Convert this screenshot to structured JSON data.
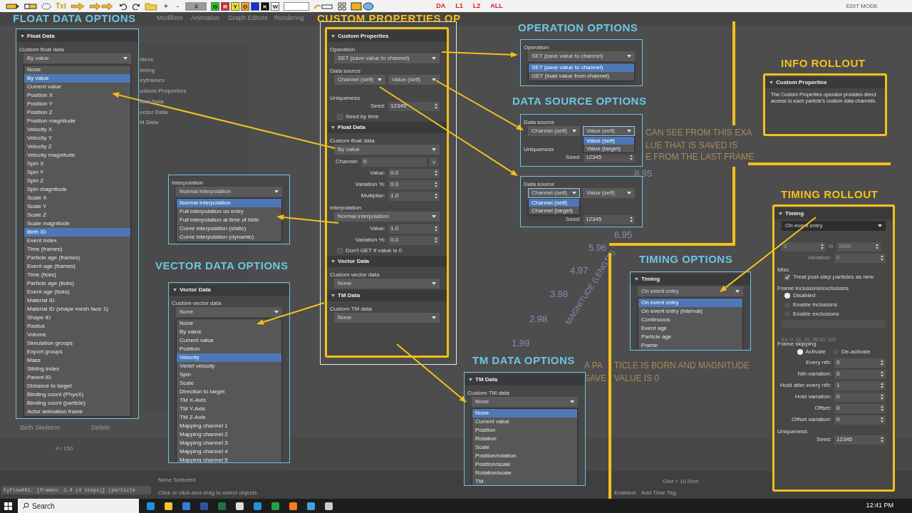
{
  "toolbar": {
    "txt": "Txt",
    "plus": "+",
    "minus": "-",
    "counter": "4",
    "swatches": [
      {
        "label": "G",
        "color": "#1fc51f"
      },
      {
        "label": "R",
        "color": "#e02424"
      },
      {
        "label": "Y",
        "color": "#f2e41c"
      },
      {
        "label": "O",
        "color": "#f0a020"
      },
      {
        "color": "#1a2bd8"
      },
      {
        "label": "K",
        "color": "#000000"
      },
      {
        "label": "W",
        "color": "#ffffff"
      }
    ],
    "tags": [
      "DA",
      "L1",
      "L2",
      "ALL"
    ],
    "mode": "EDIT MODE"
  },
  "background": {
    "menu": [
      "Modifiers",
      "Animation",
      "Graph Editors",
      "Rendering"
    ],
    "tree_items": [
      "ilters",
      "iming",
      "eyframes",
      "ustom Properties",
      "loat Data",
      "ector Data",
      "M Data"
    ],
    "axis_values": [
      "8.95",
      "6.95",
      "5.96",
      "4.97",
      "3.98",
      "2.98",
      "1.99"
    ],
    "axis_title": "MAGNITUDE (LENGTH)",
    "notes": [
      "CAN SEE FROM THIS EXA",
      "LUE THAT IS SAVED IS",
      "E FROM THE LAST FRAME",
      "A PA",
      "TICLE IS BORN AND MAGNITUDE",
      "SAVE",
      "VALUE IS 0"
    ],
    "birth_skeleton": "Birth Skeleton",
    "delete": "Delete",
    "frame_counter": "4 / 150",
    "status": [
      "None Selected",
      "Click or click-and-drag to select objects"
    ],
    "script_line": "tyFlow001: {frames: 1-4 (4 steps)} (particle",
    "enabled": "Enabled:",
    "time_tag": "Add Time Tag",
    "grid": "Grid = 10.0cm"
  },
  "callouts": [
    {
      "title": "FLOAT DATA OPTIONS",
      "color": "#6cc4e4",
      "panels": [
        {
          "rows": [
            {
              "kind": "header",
              "text": "Float Data"
            },
            {
              "kind": "group",
              "text": "Custom float data"
            },
            {
              "kind": "select",
              "value": "By value"
            },
            {
              "kind": "list",
              "items": [
                {
                  "text": "None",
                  "selected": false
                },
                {
                  "text": "By value",
                  "selected": true
                },
                {
                  "text": "Current value",
                  "selected": false
                },
                {
                  "text": "Position X",
                  "selected": false
                },
                {
                  "text": "Position Y",
                  "selected": false
                },
                {
                  "text": "Position Z",
                  "selected": false
                },
                {
                  "text": "Position magnitude",
                  "selected": false
                },
                {
                  "text": "Velocity X",
                  "selected": false
                },
                {
                  "text": "Velocity Y",
                  "selected": false
                },
                {
                  "text": "Velocity Z",
                  "selected": false
                },
                {
                  "text": "Velocity magnitude",
                  "selected": false
                },
                {
                  "text": "Spin X",
                  "selected": false
                },
                {
                  "text": "Spin Y",
                  "selected": false
                },
                {
                  "text": "Spin Z",
                  "selected": false
                },
                {
                  "text": "Spin magnitude",
                  "selected": false
                },
                {
                  "text": "Scale X",
                  "selected": false
                },
                {
                  "text": "Scale Y",
                  "selected": false
                },
                {
                  "text": "Scale Z",
                  "selected": false
                },
                {
                  "text": "Scale magnitude",
                  "selected": false
                },
                {
                  "text": "Birth ID",
                  "selected": true
                },
                {
                  "text": "Event index",
                  "selected": false
                },
                {
                  "text": "Time (frames)",
                  "selected": false
                },
                {
                  "text": "Particle age (frames)",
                  "selected": false
                },
                {
                  "text": "Event age (frames)",
                  "selected": false
                },
                {
                  "text": "Time (ticks)",
                  "selected": false
                },
                {
                  "text": "Particle age (ticks)",
                  "selected": false
                },
                {
                  "text": "Event age (ticks)",
                  "selected": false
                },
                {
                  "text": "Material ID",
                  "selected": false
                },
                {
                  "text": "Material ID (shape mesh face 1)",
                  "selected": false
                },
                {
                  "text": "Shape ID",
                  "selected": false
                },
                {
                  "text": "Radius",
                  "selected": false
                },
                {
                  "text": "Volume",
                  "selected": false
                },
                {
                  "text": "Simulation groups",
                  "selected": false
                },
                {
                  "text": "Export groups",
                  "selected": false
                },
                {
                  "text": "Mass",
                  "selected": false
                },
                {
                  "text": "Sibling index",
                  "selected": false
                },
                {
                  "text": "Parent ID",
                  "selected": false
                },
                {
                  "text": "Distance to target",
                  "selected": false
                },
                {
                  "text": "Binding count (PhysX)",
                  "selected": false
                },
                {
                  "text": "Binding count (particle)",
                  "selected": false
                },
                {
                  "text": "Actor animation frame",
                  "selected": false
                }
              ]
            }
          ]
        }
      ]
    },
    {
      "title": "CUSTOM PROPERTIES OP",
      "color": "#f2c01e",
      "panels": [
        {
          "rows": [
            {
              "kind": "header",
              "text": "Custom Properties"
            },
            {
              "kind": "group",
              "text": "Operation"
            },
            {
              "kind": "select",
              "value": "SET (save value to channel)"
            },
            {
              "kind": "group",
              "text": "Data source"
            },
            {
              "kind": "select_pair",
              "values": [
                {
                  "text": "Channel (self)",
                  "open": false
                },
                {
                  "text": "Value (self)",
                  "open": false
                }
              ]
            },
            {
              "kind": "group",
              "text": "Uniqueness"
            },
            {
              "kind": "spinner",
              "label": "Seed:",
              "value": "12345",
              "disabled": false
            },
            {
              "kind": "check",
              "label": "Seed by time",
              "checked": false
            },
            {
              "kind": "header",
              "text": "Float Data"
            },
            {
              "kind": "group",
              "text": "Custom float data"
            },
            {
              "kind": "select",
              "value": "By value"
            },
            {
              "kind": "channel",
              "label": "Channel:",
              "value": "0",
              "button": "v"
            },
            {
              "kind": "spinner",
              "label": "Value:",
              "value": "0.0",
              "disabled": false
            },
            {
              "kind": "spinner",
              "label": "Variation %:",
              "value": "0.0",
              "disabled": false
            },
            {
              "kind": "spinner",
              "label": "Multiplier:",
              "value": "1.0",
              "disabled": false
            },
            {
              "kind": "group",
              "text": "Interpolation"
            },
            {
              "kind": "select",
              "value": "Normal interpolation"
            },
            {
              "kind": "spinner",
              "label": "Value:",
              "value": "1.0",
              "disabled": false
            },
            {
              "kind": "spinner",
              "label": "Variation %:",
              "value": "0.0",
              "disabled": false
            },
            {
              "kind": "check",
              "label": "Don't GET if value is 0",
              "checked": false
            },
            {
              "kind": "header",
              "text": "Vector Data"
            },
            {
              "kind": "group",
              "text": "Custom vector data"
            },
            {
              "kind": "select",
              "value": "None"
            },
            {
              "kind": "header",
              "text": "TM Data"
            },
            {
              "kind": "group",
              "text": "Custom TM data"
            },
            {
              "kind": "select",
              "value": "None"
            }
          ]
        }
      ]
    },
    {
      "title": "OPERATION OPTIONS",
      "color": "#6cc4e4",
      "panels": [
        {
          "rows": [
            {
              "kind": "group",
              "text": "Operation"
            },
            {
              "kind": "select",
              "value": "SET (save value to channel)"
            },
            {
              "kind": "list",
              "items": [
                {
                  "text": "SET (save value to channel)",
                  "selected": true
                },
                {
                  "text": "GET (load value from channel)",
                  "selected": false
                }
              ]
            }
          ]
        }
      ]
    },
    {
      "title": "DATA SOURCE OPTIONS",
      "color": "#6cc4e4",
      "panels": [
        {
          "rows": [
            {
              "kind": "group",
              "text": "Data source"
            },
            {
              "kind": "select_pair",
              "values": [
                {
                  "text": "Channel (self)",
                  "open": false
                },
                {
                  "text": "Value (self)",
                  "open": true
                }
              ],
              "items": [
                {
                  "text": "Value (self)",
                  "selected": true
                },
                {
                  "text": "Value (target)",
                  "selected": false
                }
              ]
            },
            {
              "kind": "group",
              "text": "Uniqueness"
            },
            {
              "kind": "spinner",
              "label": "Seed:",
              "value": "12345",
              "disabled": false
            }
          ]
        },
        {
          "rows": [
            {
              "kind": "group",
              "text": "Data source"
            },
            {
              "kind": "select_pair",
              "values": [
                {
                  "text": "Channel (self)",
                  "open": true
                },
                {
                  "text": "Value (self)",
                  "open": false
                }
              ],
              "items": [
                {
                  "text": "Channel (self)",
                  "selected": true
                },
                {
                  "text": "Channel (target)",
                  "selected": false
                }
              ]
            },
            {
              "kind": "gap"
            },
            {
              "kind": "spinner",
              "label": "Seed:",
              "value": "12345",
              "disabled": false
            }
          ]
        }
      ]
    },
    {
      "title": "INFO ROLLOUT",
      "color": "#f2c01e",
      "panels": [
        {
          "rows": [
            {
              "kind": "header",
              "text": "Custom Properties"
            },
            {
              "kind": "text",
              "text": "The Custom Properties operator provides direct access to each particle's custom data channels."
            }
          ]
        }
      ]
    },
    {
      "title": "TIMING ROLLOUT",
      "color": "#f2c01e",
      "panels": [
        {
          "rows": [
            {
              "kind": "header",
              "text": "Timing"
            },
            {
              "kind": "select",
              "value": "On event entry"
            },
            {
              "kind": "gap"
            },
            {
              "kind": "range",
              "from": "0",
              "separator": "to",
              "to": "1000",
              "disabled": true
            },
            {
              "kind": "spinner",
              "label": "Variation:",
              "value": "0",
              "disabled": true
            },
            {
              "kind": "group",
              "text": "Misc"
            },
            {
              "kind": "check",
              "label": "Treat post-step particles as new",
              "checked": true
            },
            {
              "kind": "group",
              "text": "Frame inclusions/exclusions"
            },
            {
              "kind": "radio",
              "label": "Disabled",
              "selected": true
            },
            {
              "kind": "radio",
              "label": "Enable inclusions",
              "selected": false
            },
            {
              "kind": "radio",
              "label": "Enable exclusions",
              "selected": false
            },
            {
              "kind": "input"
            },
            {
              "kind": "hint",
              "text": "Ex: 0, 10, 20, 35-50, 100"
            },
            {
              "kind": "group",
              "text": "Frame skipping"
            },
            {
              "kind": "radio_row",
              "items": [
                {
                  "label": "Activate",
                  "selected": true
                },
                {
                  "label": "De-activate",
                  "selected": false
                }
              ]
            },
            {
              "kind": "spinner",
              "label": "Every nth:",
              "value": "0",
              "disabled": false
            },
            {
              "kind": "spinner",
              "label": "Nth variation:",
              "value": "0",
              "disabled": false
            },
            {
              "kind": "spinner",
              "label": "Hold after every nth:",
              "value": "1",
              "disabled": false
            },
            {
              "kind": "spinner",
              "label": "Hold variation:",
              "value": "0",
              "disabled": false
            },
            {
              "kind": "spinner",
              "label": "Offset:",
              "value": "0",
              "disabled": false
            },
            {
              "kind": "spinner",
              "label": "Offset variation:",
              "value": "0",
              "disabled": false
            },
            {
              "kind": "group",
              "text": "Uniqueness"
            },
            {
              "kind": "spinner",
              "label": "Seed:",
              "value": "12345",
              "disabled": false
            }
          ]
        }
      ]
    },
    {
      "title": "TIMING OPTIONS",
      "color": "#6cc4e4",
      "panels": [
        {
          "rows": [
            {
              "kind": "header",
              "text": "Timing"
            },
            {
              "kind": "select",
              "value": "On event entry"
            },
            {
              "kind": "list",
              "items": [
                {
                  "text": "On event entry",
                  "selected": true
                },
                {
                  "text": "On event entry (interval)",
                  "selected": false
                },
                {
                  "text": "Continuous",
                  "selected": false
                },
                {
                  "text": "Event age",
                  "selected": false
                },
                {
                  "text": "Particle age",
                  "selected": false
                },
                {
                  "text": "Frame",
                  "selected": false
                }
              ]
            }
          ]
        }
      ]
    },
    {
      "title": "VECTOR DATA OPTIONS",
      "color": "#6cc4e4",
      "panels": [
        {
          "rows": [
            {
              "kind": "header",
              "text": "Vector Data"
            },
            {
              "kind": "group",
              "text": "Custom vector data"
            },
            {
              "kind": "select",
              "value": "None"
            },
            {
              "kind": "list",
              "items": [
                {
                  "text": "None",
                  "selected": false
                },
                {
                  "text": "By value",
                  "selected": false
                },
                {
                  "text": "Current value",
                  "selected": false
                },
                {
                  "text": "Position",
                  "selected": false
                },
                {
                  "text": "Velocity",
                  "selected": true
                },
                {
                  "text": "Verlet velocity",
                  "selected": false
                },
                {
                  "text": "Spin",
                  "selected": false
                },
                {
                  "text": "Scale",
                  "selected": false
                },
                {
                  "text": "Direction to target",
                  "selected": false
                },
                {
                  "text": "TM X-Axis",
                  "selected": false
                },
                {
                  "text": "TM Y-Axis",
                  "selected": false
                },
                {
                  "text": "TM Z-Axis",
                  "selected": false
                },
                {
                  "text": "Mapping channel 1",
                  "selected": false
                },
                {
                  "text": "Mapping channel 2",
                  "selected": false
                },
                {
                  "text": "Mapping channel 3",
                  "selected": false
                },
                {
                  "text": "Mapping channel 4",
                  "selected": false
                },
                {
                  "text": "Mapping channel 5",
                  "selected": false
                }
              ]
            }
          ]
        }
      ]
    },
    {
      "title": "TM DATA OPTIONS",
      "color": "#6cc4e4",
      "panels": [
        {
          "rows": [
            {
              "kind": "header",
              "text": "TM Data"
            },
            {
              "kind": "group",
              "text": "Custom TM data"
            },
            {
              "kind": "select",
              "value": "None"
            },
            {
              "kind": "list",
              "items": [
                {
                  "text": "None",
                  "selected": true
                },
                {
                  "text": "Current value",
                  "selected": false
                },
                {
                  "text": "Position",
                  "selected": false
                },
                {
                  "text": "Rotation",
                  "selected": false
                },
                {
                  "text": "Scale",
                  "selected": false
                },
                {
                  "text": "Position/rotation",
                  "selected": false
                },
                {
                  "text": "Position/scale",
                  "selected": false
                },
                {
                  "text": "Rotation/scale",
                  "selected": false
                },
                {
                  "text": "TM",
                  "selected": false
                }
              ]
            }
          ]
        }
      ]
    },
    {
      "color": "#6cc4e4",
      "panels": [
        {
          "rows": [
            {
              "kind": "group",
              "text": "Interpolation"
            },
            {
              "kind": "select",
              "value": "Normal interpolation"
            },
            {
              "kind": "list",
              "items": [
                {
                  "text": "Normal interpolation",
                  "selected": true
                },
                {
                  "text": "Full interpolation on entry",
                  "selected": false
                },
                {
                  "text": "Full interpolation at time of birth",
                  "selected": false
                },
                {
                  "text": "Curve interpolation (static)",
                  "selected": false
                },
                {
                  "text": "Curve interpolation (dynamic)",
                  "selected": false
                }
              ]
            }
          ]
        }
      ]
    }
  ],
  "taskbar": {
    "search": "Search",
    "time": "12:41 PM"
  }
}
